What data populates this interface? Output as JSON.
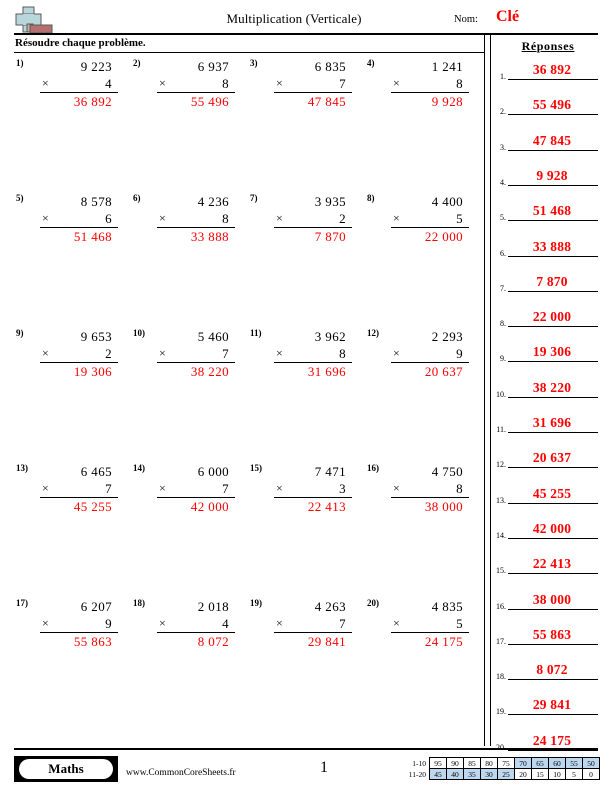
{
  "header": {
    "title": "Multiplication (Verticale)",
    "name_label": "Nom:",
    "name_value": "Clé",
    "name_color": "#ff0000",
    "logo_icon": "plus-block-logo"
  },
  "instruction": "Résoudre chaque problème.",
  "answers_panel": {
    "title": "Réponses",
    "answer_color": "#ff0000"
  },
  "problems": [
    {
      "num": "1)",
      "top": "9 223",
      "sign": "×",
      "bottom": "4",
      "answer": "36 892"
    },
    {
      "num": "2)",
      "top": "6 937",
      "sign": "×",
      "bottom": "8",
      "answer": "55 496"
    },
    {
      "num": "3)",
      "top": "6 835",
      "sign": "×",
      "bottom": "7",
      "answer": "47 845"
    },
    {
      "num": "4)",
      "top": "1 241",
      "sign": "×",
      "bottom": "8",
      "answer": "9 928"
    },
    {
      "num": "5)",
      "top": "8 578",
      "sign": "×",
      "bottom": "6",
      "answer": "51 468"
    },
    {
      "num": "6)",
      "top": "4 236",
      "sign": "×",
      "bottom": "8",
      "answer": "33 888"
    },
    {
      "num": "7)",
      "top": "3 935",
      "sign": "×",
      "bottom": "2",
      "answer": "7 870"
    },
    {
      "num": "8)",
      "top": "4 400",
      "sign": "×",
      "bottom": "5",
      "answer": "22 000"
    },
    {
      "num": "9)",
      "top": "9 653",
      "sign": "×",
      "bottom": "2",
      "answer": "19 306"
    },
    {
      "num": "10)",
      "top": "5 460",
      "sign": "×",
      "bottom": "7",
      "answer": "38 220"
    },
    {
      "num": "11)",
      "top": "3 962",
      "sign": "×",
      "bottom": "8",
      "answer": "31 696"
    },
    {
      "num": "12)",
      "top": "2 293",
      "sign": "×",
      "bottom": "9",
      "answer": "20 637"
    },
    {
      "num": "13)",
      "top": "6 465",
      "sign": "×",
      "bottom": "7",
      "answer": "45 255"
    },
    {
      "num": "14)",
      "top": "6 000",
      "sign": "×",
      "bottom": "7",
      "answer": "42 000"
    },
    {
      "num": "15)",
      "top": "7 471",
      "sign": "×",
      "bottom": "3",
      "answer": "22 413"
    },
    {
      "num": "16)",
      "top": "4 750",
      "sign": "×",
      "bottom": "8",
      "answer": "38 000"
    },
    {
      "num": "17)",
      "top": "6 207",
      "sign": "×",
      "bottom": "9",
      "answer": "55 863"
    },
    {
      "num": "18)",
      "top": "2 018",
      "sign": "×",
      "bottom": "4",
      "answer": "8 072"
    },
    {
      "num": "19)",
      "top": "4 263",
      "sign": "×",
      "bottom": "7",
      "answer": "29 841"
    },
    {
      "num": "20)",
      "top": "4 835",
      "sign": "×",
      "bottom": "5",
      "answer": "24 175"
    }
  ],
  "answer_list": [
    {
      "index": "1.",
      "value": "36 892"
    },
    {
      "index": "2.",
      "value": "55 496"
    },
    {
      "index": "3.",
      "value": "47 845"
    },
    {
      "index": "4.",
      "value": "9 928"
    },
    {
      "index": "5.",
      "value": "51 468"
    },
    {
      "index": "6.",
      "value": "33 888"
    },
    {
      "index": "7.",
      "value": "7 870"
    },
    {
      "index": "8.",
      "value": "22 000"
    },
    {
      "index": "9.",
      "value": "19 306"
    },
    {
      "index": "10.",
      "value": "38 220"
    },
    {
      "index": "11.",
      "value": "31 696"
    },
    {
      "index": "12.",
      "value": "20 637"
    },
    {
      "index": "13.",
      "value": "45 255"
    },
    {
      "index": "14.",
      "value": "42 000"
    },
    {
      "index": "15.",
      "value": "22 413"
    },
    {
      "index": "16.",
      "value": "38 000"
    },
    {
      "index": "17.",
      "value": "55 863"
    },
    {
      "index": "18.",
      "value": "8 072"
    },
    {
      "index": "19.",
      "value": "29 841"
    },
    {
      "index": "20.",
      "value": "24 175"
    }
  ],
  "footer": {
    "brand": "Maths",
    "website": "www.CommonCoreSheets.fr",
    "page_number": "1",
    "score_table": {
      "row1_label": "1-10",
      "row2_label": "11-20",
      "row1": [
        {
          "v": "95",
          "hl": false
        },
        {
          "v": "90",
          "hl": false
        },
        {
          "v": "85",
          "hl": false
        },
        {
          "v": "80",
          "hl": false
        },
        {
          "v": "75",
          "hl": false
        },
        {
          "v": "70",
          "hl": true
        },
        {
          "v": "65",
          "hl": true
        },
        {
          "v": "60",
          "hl": true
        },
        {
          "v": "55",
          "hl": true
        },
        {
          "v": "50",
          "hl": true
        }
      ],
      "row2": [
        {
          "v": "45",
          "hl": true
        },
        {
          "v": "40",
          "hl": true
        },
        {
          "v": "35",
          "hl": true
        },
        {
          "v": "30",
          "hl": true
        },
        {
          "v": "25",
          "hl": true
        },
        {
          "v": "20",
          "hl": false
        },
        {
          "v": "15",
          "hl": false
        },
        {
          "v": "10",
          "hl": false
        },
        {
          "v": "5",
          "hl": false
        },
        {
          "v": "0",
          "hl": false
        }
      ],
      "highlight_color": "#bdd7ee"
    }
  }
}
